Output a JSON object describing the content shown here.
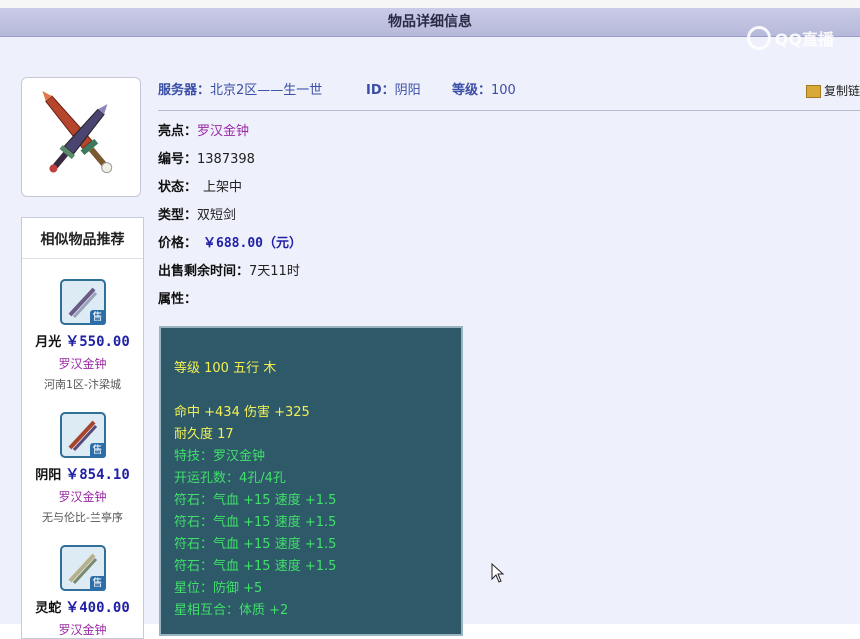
{
  "page": {
    "title": "物品详细信息"
  },
  "watermark": {
    "text": "QQ直播"
  },
  "info_bar": {
    "server_label": "服务器：",
    "server_value": "北京2区——生一世",
    "id_label": "ID：",
    "id_value": "阴阳",
    "level_label": "等级：",
    "level_value": "100",
    "copy_label": "复制链"
  },
  "details": {
    "highlight_label": "亮点：",
    "highlight_value": "罗汉金钟",
    "number_label": "编号：",
    "number_value": "1387398",
    "status_label": "状态：",
    "status_value": "上架中",
    "type_label": "类型：",
    "type_value": "双短剑",
    "price_label": "价格：",
    "price_value": "￥688.00（元）",
    "remaining_label": "出售剩余时间：",
    "remaining_value": "7天11时",
    "attributes_label": "属性："
  },
  "attributes": [
    {
      "text": "等级 100 五行 木",
      "color": "#f2f055"
    },
    {
      "text": "",
      "color": ""
    },
    {
      "text": "命中 +434 伤害 +325",
      "color": "#f2f055"
    },
    {
      "text": "耐久度 17",
      "color": "#f2f055"
    },
    {
      "text": "特技：罗汉金钟",
      "color": "#41e06b"
    },
    {
      "text": "开运孔数：4孔/4孔",
      "color": "#41e06b"
    },
    {
      "text": "符石：气血 +15 速度 +1.5",
      "color": "#41e06b"
    },
    {
      "text": "符石：气血 +15 速度 +1.5",
      "color": "#41e06b"
    },
    {
      "text": "符石：气血 +15 速度 +1.5",
      "color": "#41e06b"
    },
    {
      "text": "符石：气血 +15 速度 +1.5",
      "color": "#41e06b"
    },
    {
      "text": "星位：防御 +5",
      "color": "#41e06b"
    },
    {
      "text": "星相互合：体质 +2",
      "color": "#41e06b"
    }
  ],
  "similar": {
    "title": "相似物品推荐",
    "items": [
      {
        "name": "月光",
        "price": "￥550.00",
        "skill": "罗汉金钟",
        "server": "河南1区-汴梁城",
        "badge": "售"
      },
      {
        "name": "阴阳",
        "price": "￥854.10",
        "skill": "罗汉金钟",
        "server": "无与伦比-兰亭序",
        "badge": "售"
      },
      {
        "name": "灵蛇",
        "price": "￥400.00",
        "skill": "罗汉金钟",
        "server": "",
        "badge": "售"
      }
    ]
  },
  "colors": {
    "title_bar": "#b6b9da",
    "background": "#eef0fb",
    "attr_box": "#2d5968",
    "price": "#2121a8",
    "skill": "#9b2aa5"
  }
}
